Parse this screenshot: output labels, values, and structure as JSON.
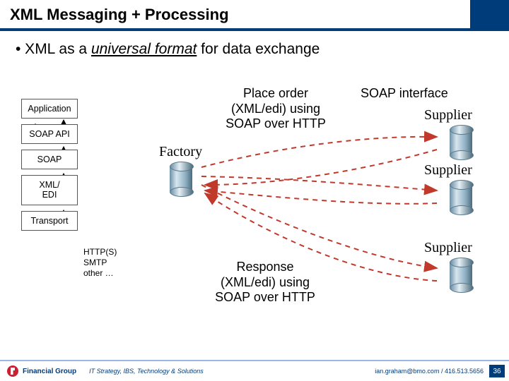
{
  "title": "XML Messaging + Processing",
  "bullet": {
    "prefix": "• XML as a ",
    "underlined": "universal format",
    "suffix": "  for data exchange"
  },
  "stack": {
    "application": "Application",
    "soap_api": "SOAP API",
    "soap": "SOAP",
    "xml_edi": "XML/\nEDI",
    "transport": "Transport"
  },
  "transports": "HTTP(S)\nSMTP\nother …",
  "nodes": {
    "factory": "Factory",
    "supplier1": "Supplier",
    "supplier2": "Supplier",
    "supplier3": "Supplier"
  },
  "annotations": {
    "place_order": "Place order\n(XML/edi) using\nSOAP over HTTP",
    "soap_interface": "SOAP interface",
    "response": "Response\n(XML/edi) using\nSOAP over HTTP"
  },
  "footer": {
    "brand": "Financial Group",
    "dept": "IT Strategy, IBS, Technology & Solutions",
    "contact": "ian.graham@bmo.com / 416.513.5656",
    "page": "36"
  }
}
